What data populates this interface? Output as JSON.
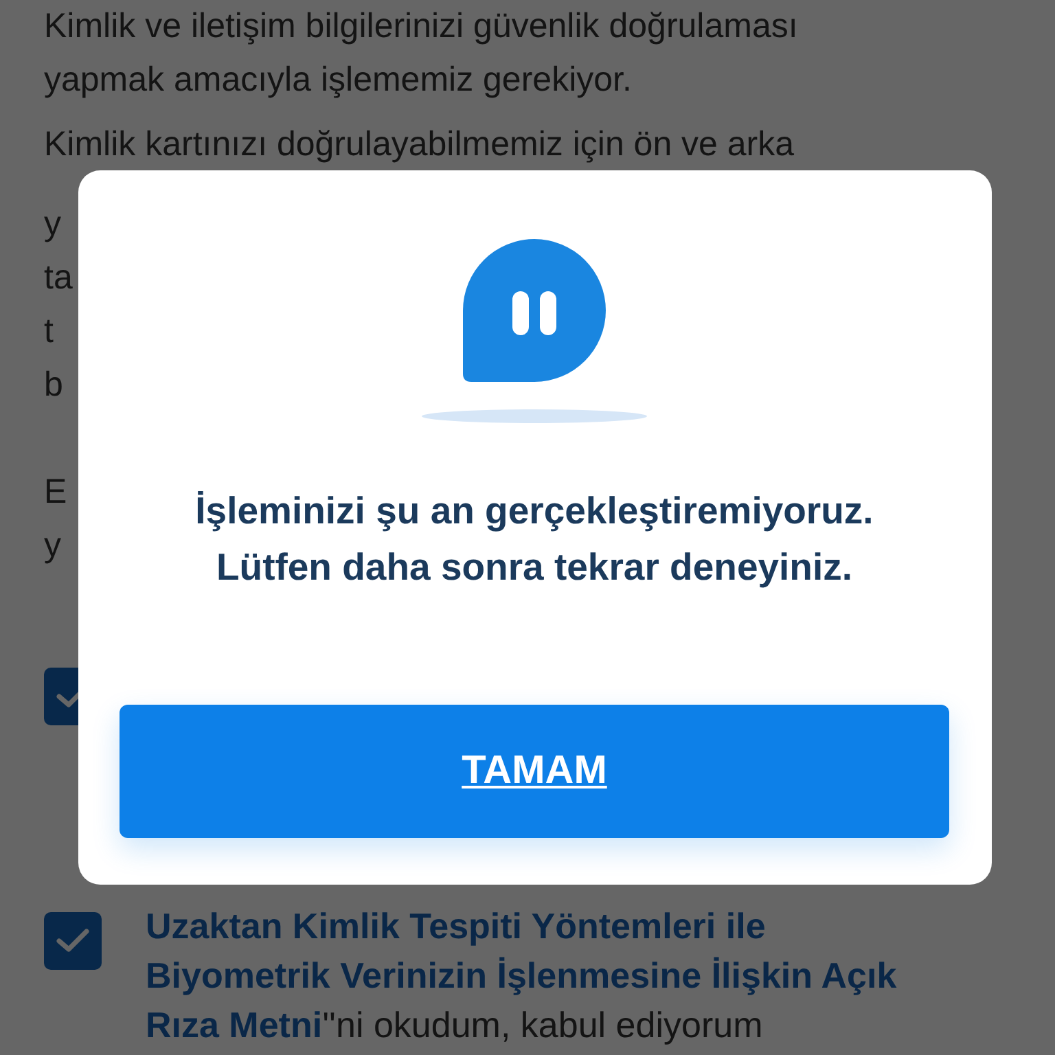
{
  "page": {
    "paragraphs": [
      [
        "Kimlik ve iletişim bilgilerinizi güvenlik doğrulaması",
        "yapmak amacıyla işlememiz gerekiyor."
      ],
      [
        "Kimlik kartınızı doğrulayabilmemiz için ön ve arka",
        "y",
        "ta",
        "t",
        "b"
      ],
      [
        "E",
        "y"
      ]
    ],
    "consents": [
      {
        "checked": true
      },
      {
        "checked": true,
        "text": "**Uzaktan Kimlik Tespiti Yöntemleri ile Biyometrik Verinizin İşlenmesine İlişkin Açık Rıza Metni**''ni okudum, kabul ediyorum"
      }
    ]
  },
  "dialog": {
    "message": [
      "İşleminizi şu an gerçekleştiremiyoruz.",
      "Lütfen daha sonra tekrar deneyiniz."
    ],
    "button": "TAMAM"
  }
}
